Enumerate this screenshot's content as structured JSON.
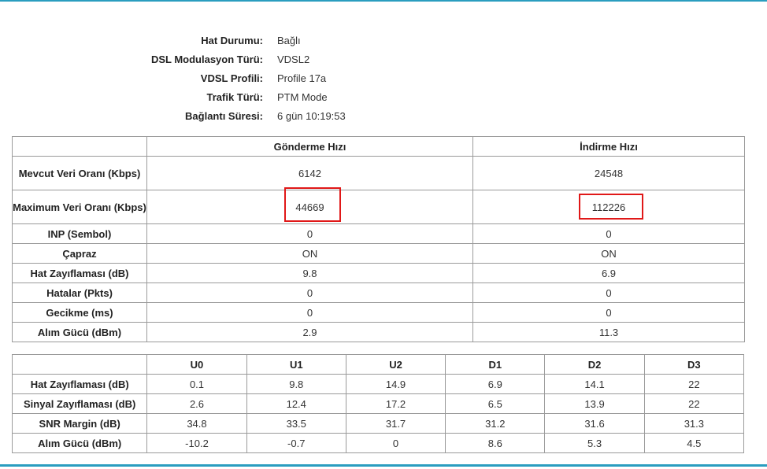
{
  "colors": {
    "accent": "#2a9dbf",
    "highlight": "#e01818"
  },
  "status": [
    {
      "label": "Hat Durumu:",
      "value": "Bağlı"
    },
    {
      "label": "DSL Modulasyon Türü:",
      "value": "VDSL2"
    },
    {
      "label": "VDSL Profili:",
      "value": "Profile 17a"
    },
    {
      "label": "Trafik Türü:",
      "value": "PTM Mode"
    },
    {
      "label": "Bağlantı Süresi:",
      "value": "6 gün 10:19:53"
    }
  ],
  "rates_table": {
    "headers": [
      "",
      "Gönderme Hızı",
      "İndirme Hızı"
    ],
    "rows": [
      {
        "label": "Mevcut Veri Oranı (Kbps)",
        "upload": "6142",
        "download": "24548"
      },
      {
        "label": "Maximum Veri Oranı (Kbps)",
        "upload": "44669",
        "download": "112226"
      },
      {
        "label": "INP (Sembol)",
        "upload": "0",
        "download": "0"
      },
      {
        "label": "Çapraz",
        "upload": "ON",
        "download": "ON"
      },
      {
        "label": "Hat Zayıflaması (dB)",
        "upload": "9.8",
        "download": "6.9"
      },
      {
        "label": "Hatalar (Pkts)",
        "upload": "0",
        "download": "0"
      },
      {
        "label": "Gecikme (ms)",
        "upload": "0",
        "download": "0"
      },
      {
        "label": "Alım Gücü (dBm)",
        "upload": "2.9",
        "download": "11.3"
      }
    ]
  },
  "band_table": {
    "headers": [
      "",
      "U0",
      "U1",
      "U2",
      "D1",
      "D2",
      "D3"
    ],
    "rows": [
      {
        "label": "Hat Zayıflaması (dB)",
        "values": [
          "0.1",
          "9.8",
          "14.9",
          "6.9",
          "14.1",
          "22"
        ]
      },
      {
        "label": "Sinyal Zayıflaması (dB)",
        "values": [
          "2.6",
          "12.4",
          "17.2",
          "6.5",
          "13.9",
          "22"
        ]
      },
      {
        "label": "SNR Margin (dB)",
        "values": [
          "34.8",
          "33.5",
          "31.7",
          "31.2",
          "31.6",
          "31.3"
        ]
      },
      {
        "label": "Alım Gücü (dBm)",
        "values": [
          "-10.2",
          "-0.7",
          "0",
          "8.6",
          "5.3",
          "4.5"
        ]
      }
    ]
  }
}
